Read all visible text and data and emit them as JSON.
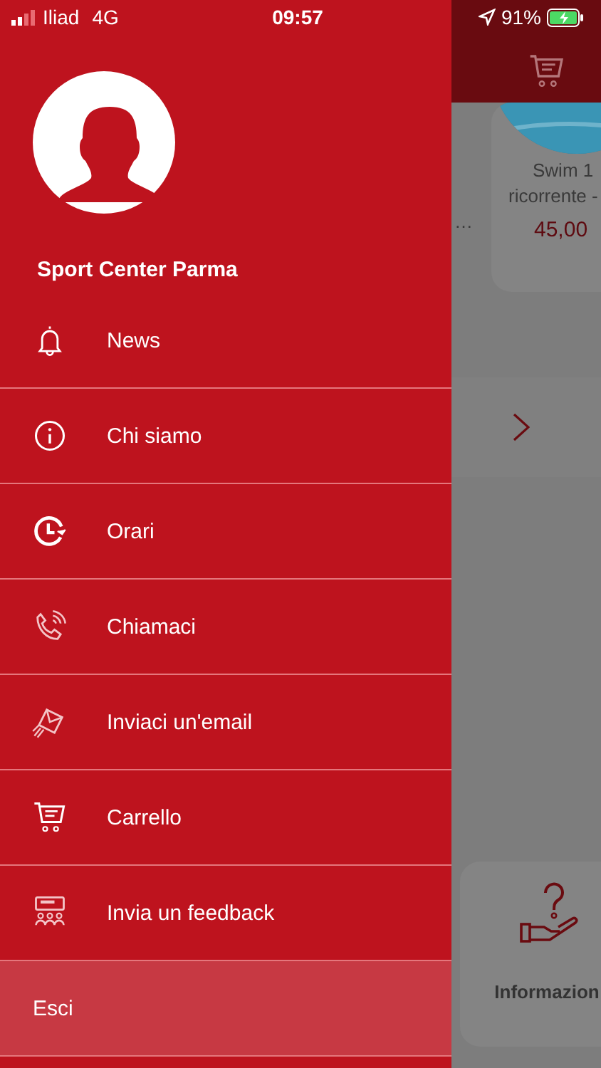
{
  "status_bar": {
    "carrier": "Iliad",
    "network": "4G",
    "time": "09:57",
    "battery": "91%"
  },
  "drawer": {
    "user_name": "Sport Center Parma",
    "items": [
      {
        "kind": "bell",
        "label": "News"
      },
      {
        "kind": "info",
        "label": "Chi siamo"
      },
      {
        "kind": "clock",
        "label": "Orari"
      },
      {
        "kind": "phone",
        "label": "Chiamaci"
      },
      {
        "kind": "mail",
        "label": "Inviaci un'email"
      },
      {
        "kind": "cart",
        "label": "Carrello"
      },
      {
        "kind": "feedback",
        "label": "Invia un feedback"
      }
    ],
    "logout": {
      "label": "Esci"
    }
  },
  "background_page": {
    "cut_text": "…",
    "product": {
      "title_line_1": "Swim 1",
      "title_line_2": "ricorrente -",
      "price": "45,00"
    },
    "info_card": {
      "label": "Informazion"
    }
  }
}
